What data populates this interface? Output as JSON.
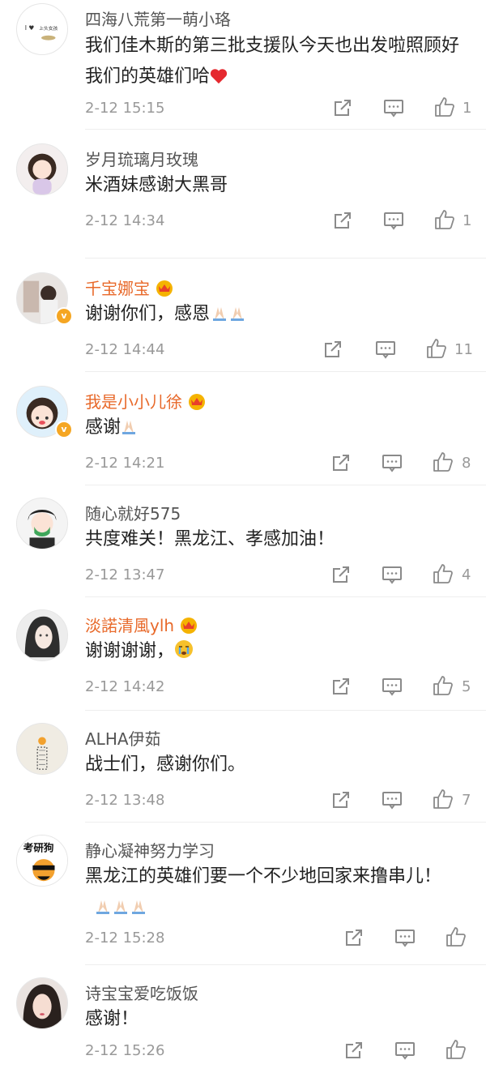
{
  "comments": [
    {
      "name": "四海八荒第一萌小珞",
      "text": "我们佳木斯的第三批支援队今天也出发啦照顾好我们的英雄们哈",
      "emoji": "red-heart",
      "time": "2-12 15:15",
      "likes": "1",
      "vip": false
    },
    {
      "name": "岁月琉璃月玫瑰",
      "text": "米酒妹感谢大黑哥",
      "time": "2-12 14:34",
      "likes": "1",
      "vip": false
    },
    {
      "name": "千宝娜宝",
      "text": "谢谢你们，感恩",
      "emoji": "praying-hands-x2",
      "time": "2-12 14:44",
      "likes": "11",
      "vip": true
    },
    {
      "name": "我是小小儿徐",
      "text": "感谢",
      "emoji": "praying-hands",
      "time": "2-12 14:21",
      "likes": "8",
      "vip": true
    },
    {
      "name": "随心就好575",
      "text": "共度难关！黑龙江、孝感加油！",
      "time": "2-12 13:47",
      "likes": "4",
      "vip": false
    },
    {
      "name": "淡諾清風ylh",
      "text": "谢谢谢谢，",
      "emoji": "crying-face",
      "time": "2-12 14:42",
      "likes": "5",
      "vip": true
    },
    {
      "name": "ALHA伊茹",
      "text": "战士们，感谢你们。",
      "time": "2-12 13:48",
      "likes": "7",
      "vip": false
    },
    {
      "name": "静心凝神努力学习",
      "text": "黑龙江的英雄们要一个不少地回家来撸串儿！",
      "emoji": "praying-hands-x3",
      "time": "2-12 15:28",
      "likes": "",
      "vip": false,
      "avatar_text": "考研狗"
    },
    {
      "name": "诗宝宝爱吃饭饭",
      "text": "感谢！",
      "time": "2-12 15:26",
      "likes": "",
      "vip": false
    }
  ],
  "avatar_top_texts": {
    "first": "上头女孩"
  },
  "icons": {
    "forward": "forward-icon",
    "comment": "comment-icon",
    "like": "thumbs-up-icon"
  },
  "colors": {
    "name": "#555555",
    "vip_name": "#e8692a",
    "text": "#222222",
    "meta": "#999999"
  }
}
